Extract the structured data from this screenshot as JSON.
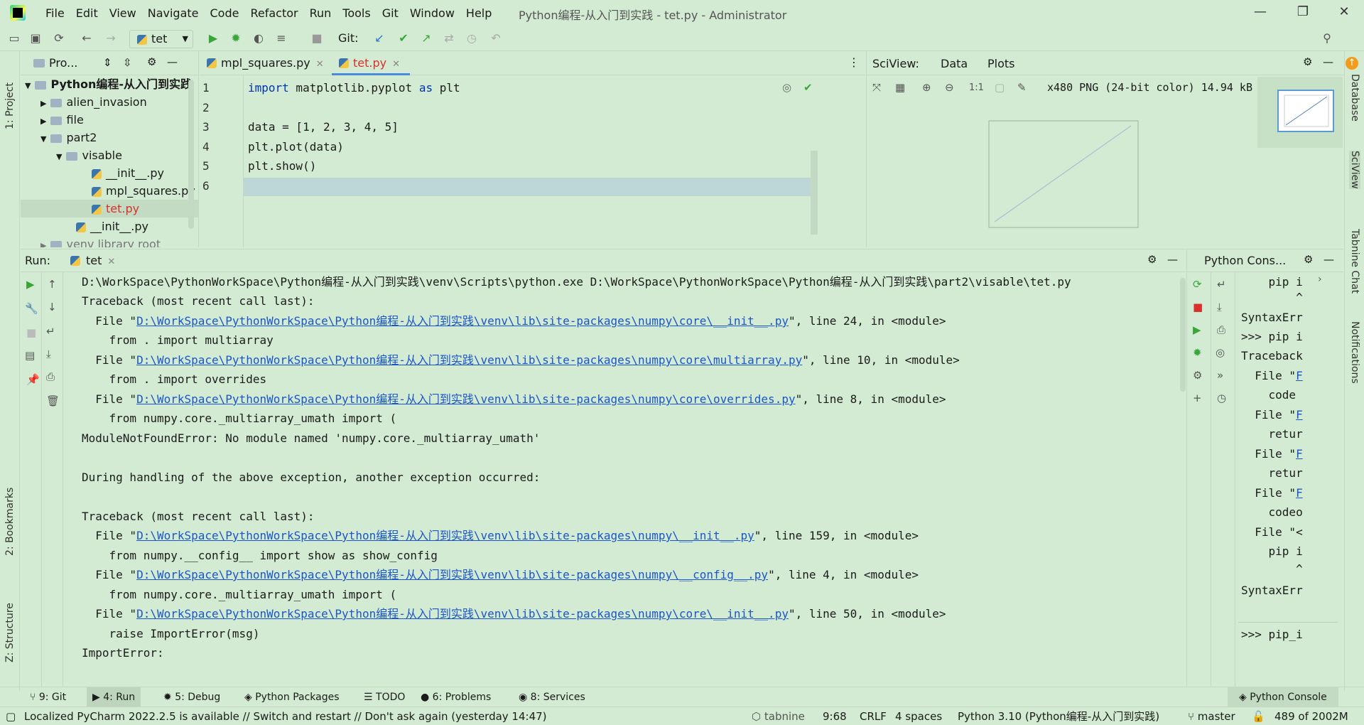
{
  "window": {
    "title": "Python编程-从入门到实践 - tet.py - Administrator",
    "menu": [
      "File",
      "Edit",
      "View",
      "Navigate",
      "Code",
      "Refactor",
      "Run",
      "Tools",
      "Git",
      "Window",
      "Help"
    ]
  },
  "toolbar": {
    "run_config": "tet",
    "git_label": "Git:"
  },
  "left_stripe": {
    "project": "1: Project",
    "bookmarks": "2: Bookmarks",
    "structure": "Z: Structure"
  },
  "right_stripe": {
    "database": "Database",
    "sciview": "SciView",
    "tabnine": "Tabnine Chat",
    "notifications": "Notifications"
  },
  "project": {
    "header": "Pro...",
    "items": [
      {
        "label": "Python编程-从入门到实践"
      },
      {
        "label": "alien_invasion"
      },
      {
        "label": "file"
      },
      {
        "label": "part2"
      },
      {
        "label": "visable"
      },
      {
        "label": "__init__.py"
      },
      {
        "label": "mpl_squares.py"
      },
      {
        "label": "tet.py"
      },
      {
        "label": "__init__.py"
      },
      {
        "label": "venv  library root"
      }
    ]
  },
  "editor": {
    "tabs": [
      {
        "label": "mpl_squares.py"
      },
      {
        "label": "tet.py"
      }
    ],
    "line_numbers": [
      "1",
      "2",
      "3",
      "4",
      "5",
      "6"
    ],
    "lines": [
      {
        "kw": "import",
        "rest": " matplotlib.pyplot ",
        "kw2": "as",
        "rest2": " plt"
      },
      {
        "text": ""
      },
      {
        "text": "data = [1, 2, 3, 4, 5]"
      },
      {
        "text": "plt.plot(data)"
      },
      {
        "text": "plt.show()"
      },
      {
        "text": ""
      }
    ]
  },
  "sciview": {
    "title": "SciView:",
    "tabs": [
      "Data",
      "Plots"
    ],
    "image_info": "x480 PNG (24-bit color) 14.94 kB",
    "zoom_label": "1:1"
  },
  "run": {
    "label": "Run:",
    "tab": "tet",
    "output": [
      {
        "t": "D:\\WorkSpace\\PythonWorkSpace\\Python编程-从入门到实践\\venv\\Scripts\\python.exe D:\\WorkSpace\\PythonWorkSpace\\Python编程-从入门到实践\\part2\\visable\\tet.py"
      },
      {
        "t": "Traceback (most recent call last):"
      },
      {
        "pre": "  File \"",
        "link": "D:\\WorkSpace\\PythonWorkSpace\\Python编程-从入门到实践\\venv\\lib\\site-packages\\numpy\\core\\__init__.py",
        "post": "\", line 24, in <module>"
      },
      {
        "t": "    from . import multiarray"
      },
      {
        "pre": "  File \"",
        "link": "D:\\WorkSpace\\PythonWorkSpace\\Python编程-从入门到实践\\venv\\lib\\site-packages\\numpy\\core\\multiarray.py",
        "post": "\", line 10, in <module>"
      },
      {
        "t": "    from . import overrides"
      },
      {
        "pre": "  File \"",
        "link": "D:\\WorkSpace\\PythonWorkSpace\\Python编程-从入门到实践\\venv\\lib\\site-packages\\numpy\\core\\overrides.py",
        "post": "\", line 8, in <module>"
      },
      {
        "t": "    from numpy.core._multiarray_umath import ("
      },
      {
        "t": "ModuleNotFoundError: No module named 'numpy.core._multiarray_umath'"
      },
      {
        "t": ""
      },
      {
        "t": "During handling of the above exception, another exception occurred:"
      },
      {
        "t": ""
      },
      {
        "t": "Traceback (most recent call last):"
      },
      {
        "pre": "  File \"",
        "link": "D:\\WorkSpace\\PythonWorkSpace\\Python编程-从入门到实践\\venv\\lib\\site-packages\\numpy\\__init__.py",
        "post": "\", line 159, in <module>"
      },
      {
        "t": "    from numpy.__config__ import show as show_config"
      },
      {
        "pre": "  File \"",
        "link": "D:\\WorkSpace\\PythonWorkSpace\\Python编程-从入门到实践\\venv\\lib\\site-packages\\numpy\\__config__.py",
        "post": "\", line 4, in <module>"
      },
      {
        "t": "    from numpy.core._multiarray_umath import ("
      },
      {
        "pre": "  File \"",
        "link": "D:\\WorkSpace\\PythonWorkSpace\\Python编程-从入门到实践\\venv\\lib\\site-packages\\numpy\\core\\__init__.py",
        "post": "\", line 50, in <module>"
      },
      {
        "t": "    raise ImportError(msg)"
      },
      {
        "t": "ImportError:"
      }
    ]
  },
  "python_console": {
    "title": "Python Cons...",
    "lines": [
      {
        "a": "    pip i"
      },
      {
        "a": "        ^"
      },
      {
        "a": "SyntaxErr"
      },
      {
        "a": ">>> pip i"
      },
      {
        "a": "Traceback"
      },
      {
        "a": "  File \"",
        "b": "F"
      },
      {
        "a": "    code "
      },
      {
        "a": "  File \"",
        "b": "F"
      },
      {
        "a": "    retur"
      },
      {
        "a": "  File \"",
        "b": "F"
      },
      {
        "a": "    retur"
      },
      {
        "a": "  File \"",
        "b": "F"
      },
      {
        "a": "    codeo"
      },
      {
        "a": "  File \"<"
      },
      {
        "a": "    pip i"
      },
      {
        "a": "        ^"
      },
      {
        "a": "SyntaxErr"
      }
    ],
    "prompt": ">>> pip_i"
  },
  "bottom_tabs": {
    "git": "9: Git",
    "run": "4: Run",
    "debug": "5: Debug",
    "packages": "Python Packages",
    "todo": "TODO",
    "problems": "6: Problems",
    "services": "8: Services",
    "console": "Python Console"
  },
  "status": {
    "message": "Localized PyCharm 2022.2.5 is available // Switch and restart // Don't ask again (yesterday 14:47)",
    "tabnine": "tabnine",
    "position": "9:68",
    "line_sep": "CRLF",
    "indent": "4 spaces",
    "interpreter": "Python 3.10 (Python编程-从入门到实践)",
    "branch": "master",
    "memory": "489 of 2002M"
  },
  "colors": {
    "background": "#d3ead3",
    "link": "#1a56c9",
    "keyword": "#0033b3",
    "run_green": "#3aa63a",
    "stop_red": "#d9302c"
  }
}
